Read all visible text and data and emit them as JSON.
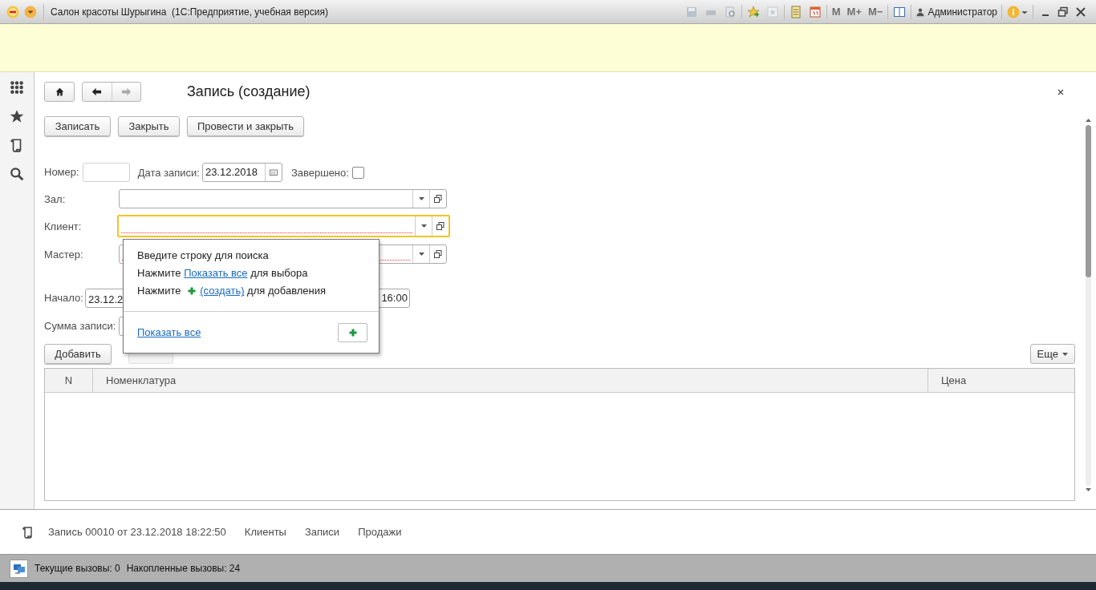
{
  "window": {
    "title": "Салон красоты Шурыгина  (1С:Предприятие, учебная версия)",
    "memory_buttons": [
      "M",
      "M+",
      "M−"
    ],
    "user": "Администратор"
  },
  "form": {
    "title": "Запись (создание)",
    "commands": [
      "Записать",
      "Закрыть",
      "Провести и закрыть"
    ],
    "number": {
      "label": "Номер:"
    },
    "date": {
      "label": "Дата записи:",
      "value": "23.12.2018"
    },
    "completed": {
      "label": "Завершено:",
      "checked": false
    },
    "refs": [
      {
        "label": "Зал:",
        "focused": false,
        "invalid": false
      },
      {
        "label": "Клиент:",
        "focused": true,
        "invalid": true
      },
      {
        "label": "Мастер:",
        "focused": false,
        "invalid": true
      }
    ],
    "start": {
      "label": "Начало:",
      "date": "23.12.2",
      "time": "16:00"
    },
    "sum": {
      "label": "Сумма записи:"
    },
    "table": {
      "add_button": "Добавить",
      "more_button": "Еще",
      "columns": [
        "N",
        "Номенклатура",
        "Цена"
      ]
    }
  },
  "popup": {
    "lines": [
      [
        {
          "kind": "text",
          "text": "Введите строку для поиска"
        }
      ],
      [
        {
          "kind": "text",
          "text": "Нажмите "
        },
        {
          "kind": "link",
          "text": "Показать все"
        },
        {
          "kind": "text",
          "text": " для выбора"
        }
      ],
      [
        {
          "kind": "text",
          "text": "Нажмите "
        },
        {
          "kind": "plus"
        },
        {
          "kind": "link",
          "text": "(создать)"
        },
        {
          "kind": "text",
          "text": " для добавления"
        }
      ]
    ],
    "show_all": "Показать все"
  },
  "footer": {
    "items": [
      "Запись 00010 от 23.12.2018 18:22:50",
      "Клиенты",
      "Записи",
      "Продажи"
    ]
  },
  "status_bar": {
    "items": [
      "Текущие вызовы: 0",
      "Накопленные вызовы: 24"
    ]
  }
}
